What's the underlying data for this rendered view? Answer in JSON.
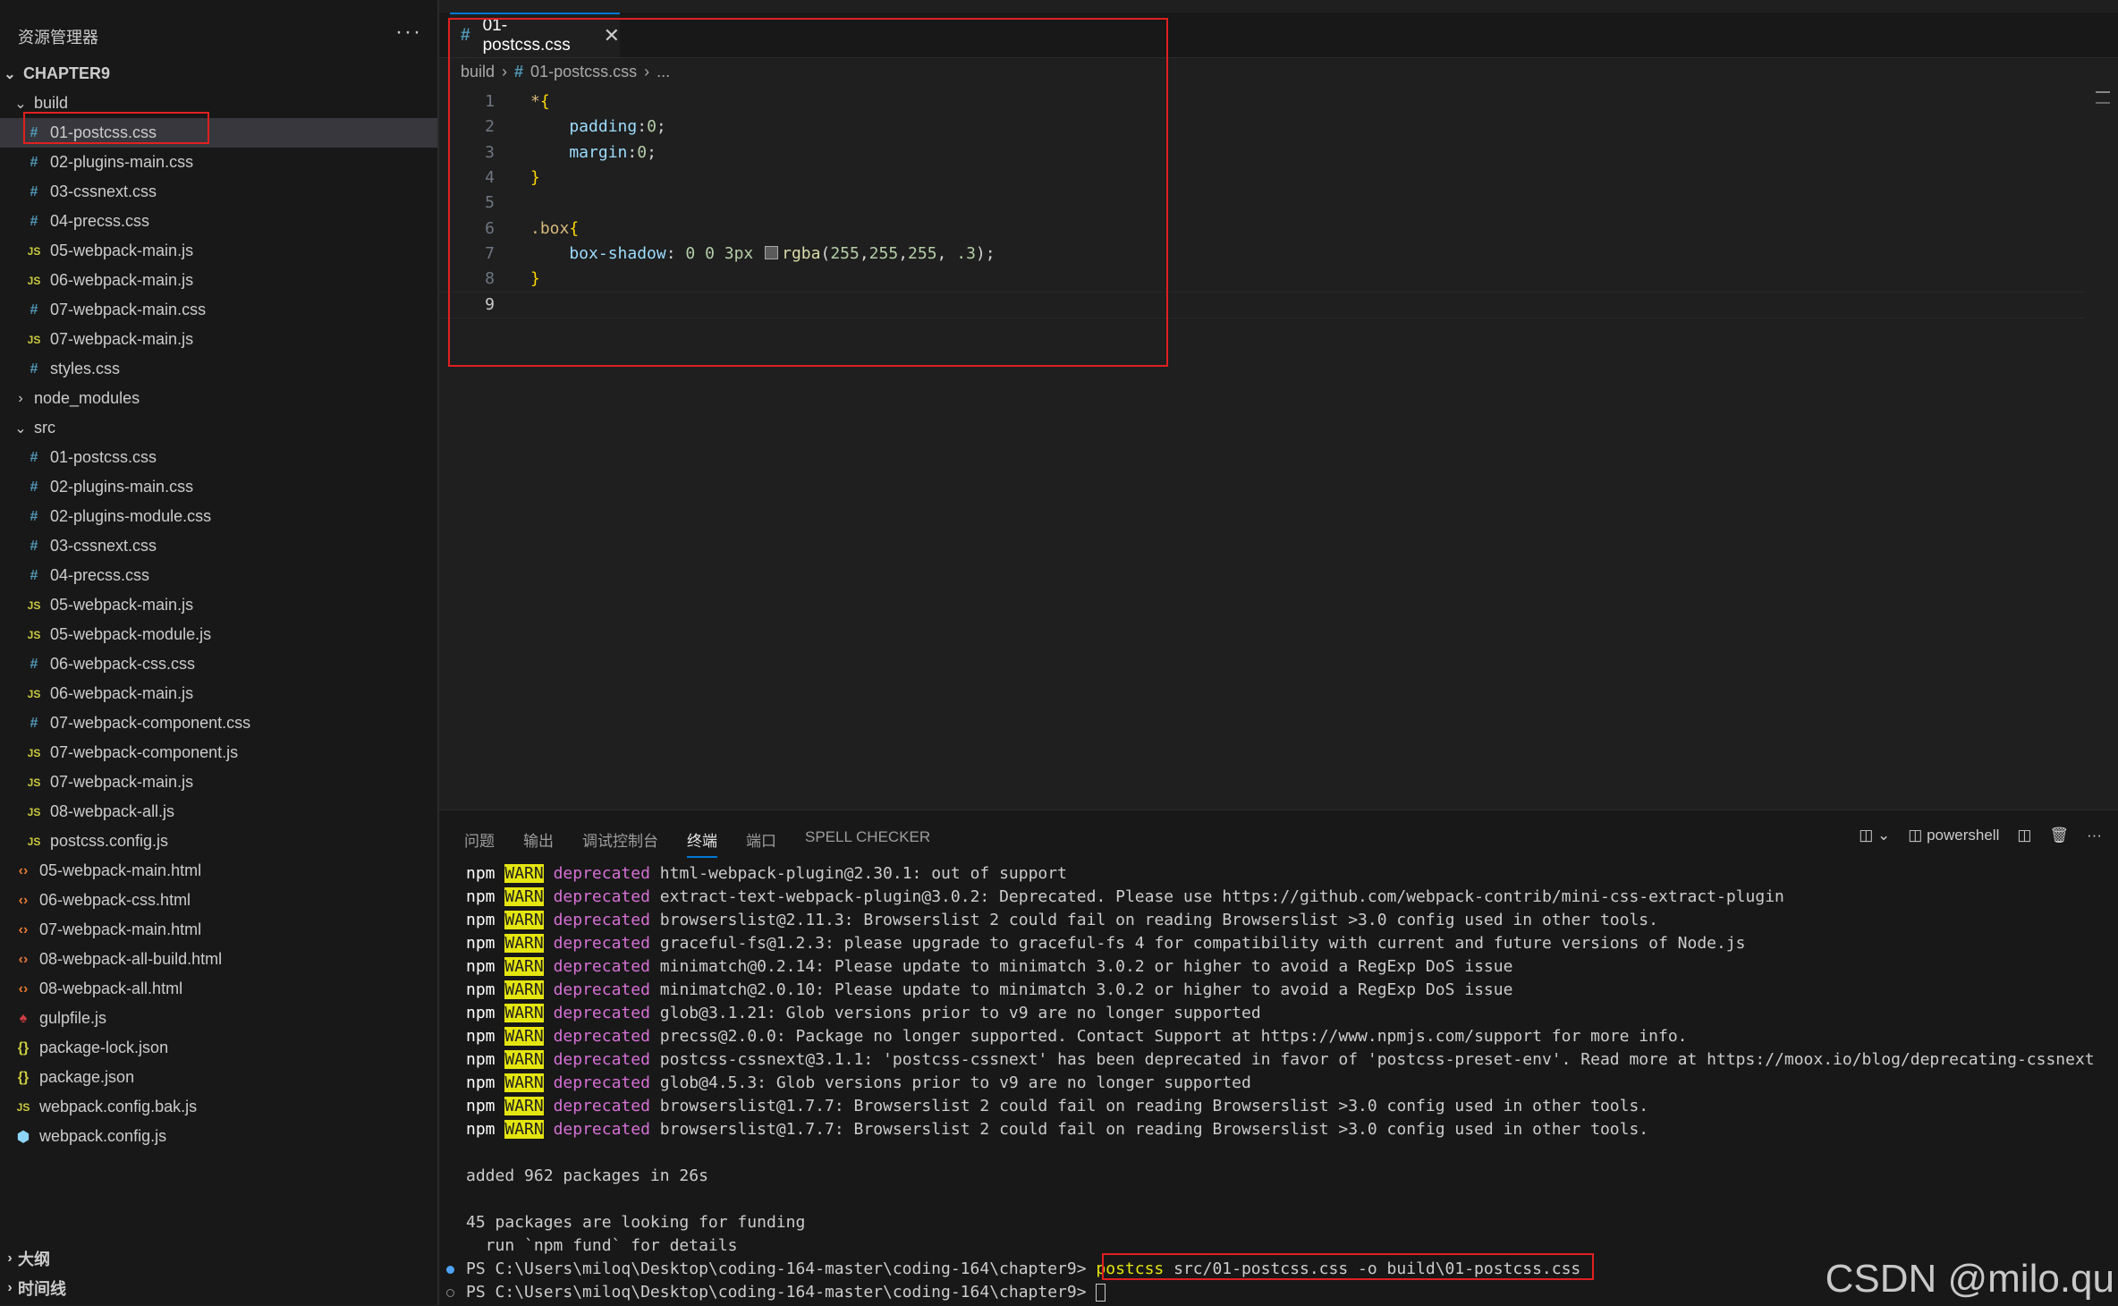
{
  "explorer": {
    "title": "资源管理器",
    "more": "···",
    "project": "CHAPTER9",
    "items": [
      {
        "label": "CHAPTER9",
        "type": "root",
        "depth": 0,
        "expanded": true
      },
      {
        "label": "build",
        "type": "folder",
        "depth": 1,
        "expanded": true
      },
      {
        "label": "01-postcss.css",
        "type": "css",
        "depth": 2,
        "selected": true
      },
      {
        "label": "02-plugins-main.css",
        "type": "css",
        "depth": 2
      },
      {
        "label": "03-cssnext.css",
        "type": "css",
        "depth": 2
      },
      {
        "label": "04-precss.css",
        "type": "css",
        "depth": 2
      },
      {
        "label": "05-webpack-main.js",
        "type": "js",
        "depth": 2
      },
      {
        "label": "06-webpack-main.js",
        "type": "js",
        "depth": 2
      },
      {
        "label": "07-webpack-main.css",
        "type": "css",
        "depth": 2
      },
      {
        "label": "07-webpack-main.js",
        "type": "js",
        "depth": 2
      },
      {
        "label": "styles.css",
        "type": "css",
        "depth": 2
      },
      {
        "label": "node_modules",
        "type": "folder",
        "depth": 1,
        "expanded": false
      },
      {
        "label": "src",
        "type": "folder",
        "depth": 1,
        "expanded": true
      },
      {
        "label": "01-postcss.css",
        "type": "css",
        "depth": 2
      },
      {
        "label": "02-plugins-main.css",
        "type": "css",
        "depth": 2
      },
      {
        "label": "02-plugins-module.css",
        "type": "css",
        "depth": 2
      },
      {
        "label": "03-cssnext.css",
        "type": "css",
        "depth": 2
      },
      {
        "label": "04-precss.css",
        "type": "css",
        "depth": 2
      },
      {
        "label": "05-webpack-main.js",
        "type": "js",
        "depth": 2
      },
      {
        "label": "05-webpack-module.js",
        "type": "js",
        "depth": 2
      },
      {
        "label": "06-webpack-css.css",
        "type": "css",
        "depth": 2
      },
      {
        "label": "06-webpack-main.js",
        "type": "js",
        "depth": 2
      },
      {
        "label": "07-webpack-component.css",
        "type": "css",
        "depth": 2
      },
      {
        "label": "07-webpack-component.js",
        "type": "js",
        "depth": 2
      },
      {
        "label": "07-webpack-main.js",
        "type": "js",
        "depth": 2
      },
      {
        "label": "08-webpack-all.js",
        "type": "js",
        "depth": 2
      },
      {
        "label": "postcss.config.js",
        "type": "js",
        "depth": 2
      },
      {
        "label": "05-webpack-main.html",
        "type": "html",
        "depth": 1
      },
      {
        "label": "06-webpack-css.html",
        "type": "html",
        "depth": 1
      },
      {
        "label": "07-webpack-main.html",
        "type": "html",
        "depth": 1
      },
      {
        "label": "08-webpack-all-build.html",
        "type": "html",
        "depth": 1
      },
      {
        "label": "08-webpack-all.html",
        "type": "html",
        "depth": 1
      },
      {
        "label": "gulpfile.js",
        "type": "gulp",
        "depth": 1
      },
      {
        "label": "package-lock.json",
        "type": "json",
        "depth": 1
      },
      {
        "label": "package.json",
        "type": "json",
        "depth": 1
      },
      {
        "label": "webpack.config.bak.js",
        "type": "js",
        "depth": 1
      },
      {
        "label": "webpack.config.js",
        "type": "webpack",
        "depth": 1
      }
    ],
    "outline": "大纲",
    "timeline": "时间线"
  },
  "editor": {
    "tab_label": "01-postcss.css",
    "tab_close": "✕",
    "breadcrumb": [
      "build",
      "01-postcss.css",
      "..."
    ],
    "active_line": 9,
    "lines": [
      {
        "n": "1",
        "tokens": [
          {
            "t": "*",
            "c": "t-sel"
          },
          {
            "t": "{",
            "c": "t-br"
          }
        ]
      },
      {
        "n": "2",
        "tokens": [
          {
            "t": "    padding",
            "c": "t-prop"
          },
          {
            "t": ":",
            "c": "t-punc"
          },
          {
            "t": "0",
            "c": "t-num"
          },
          {
            "t": ";",
            "c": "t-punc"
          }
        ]
      },
      {
        "n": "3",
        "tokens": [
          {
            "t": "    margin",
            "c": "t-prop"
          },
          {
            "t": ":",
            "c": "t-punc"
          },
          {
            "t": "0",
            "c": "t-num"
          },
          {
            "t": ";",
            "c": "t-punc"
          }
        ]
      },
      {
        "n": "4",
        "tokens": [
          {
            "t": "}",
            "c": "t-br"
          }
        ]
      },
      {
        "n": "5",
        "tokens": []
      },
      {
        "n": "6",
        "tokens": [
          {
            "t": ".box",
            "c": "t-sel"
          },
          {
            "t": "{",
            "c": "t-br"
          }
        ]
      },
      {
        "n": "7",
        "tokens": [
          {
            "t": "    box-shadow",
            "c": "t-prop"
          },
          {
            "t": ": ",
            "c": "t-punc"
          },
          {
            "t": "0 0 3px ",
            "c": "t-num"
          },
          {
            "swatch": true
          },
          {
            "t": "rgba",
            "c": "t-fn"
          },
          {
            "t": "(",
            "c": "t-punc"
          },
          {
            "t": "255",
            "c": "t-num"
          },
          {
            "t": ",",
            "c": "t-punc"
          },
          {
            "t": "255",
            "c": "t-num"
          },
          {
            "t": ",",
            "c": "t-punc"
          },
          {
            "t": "255",
            "c": "t-num"
          },
          {
            "t": ", ",
            "c": "t-punc"
          },
          {
            "t": ".3",
            "c": "t-num"
          },
          {
            "t": ");",
            "c": "t-punc"
          }
        ]
      },
      {
        "n": "8",
        "tokens": [
          {
            "t": "}",
            "c": "t-br"
          }
        ]
      },
      {
        "n": "9",
        "tokens": []
      }
    ]
  },
  "panel": {
    "tabs": [
      "问题",
      "输出",
      "调试控制台",
      "终端",
      "端口",
      "SPELL CHECKER"
    ],
    "active_tab": "终端",
    "shell": "powershell",
    "terminal": {
      "warnings": [
        {
          "pkg": "html-webpack-plugin@2.30.1: out of support"
        },
        {
          "pkg": "extract-text-webpack-plugin@3.0.2: Deprecated. Please use https://github.com/webpack-contrib/mini-css-extract-plugin"
        },
        {
          "pkg": "browserslist@2.11.3: Browserslist 2 could fail on reading Browserslist >3.0 config used in other tools."
        },
        {
          "pkg": "graceful-fs@1.2.3: please upgrade to graceful-fs 4 for compatibility with current and future versions of Node.js"
        },
        {
          "pkg": "minimatch@0.2.14: Please update to minimatch 3.0.2 or higher to avoid a RegExp DoS issue"
        },
        {
          "pkg": "minimatch@2.0.10: Please update to minimatch 3.0.2 or higher to avoid a RegExp DoS issue"
        },
        {
          "pkg": "glob@3.1.21: Glob versions prior to v9 are no longer supported"
        },
        {
          "pkg": "precss@2.0.0: Package no longer supported. Contact Support at https://www.npmjs.com/support for more info."
        },
        {
          "pkg": "postcss-cssnext@3.1.1: 'postcss-cssnext' has been deprecated in favor of 'postcss-preset-env'. Read more at https://moox.io/blog/deprecating-cssnext"
        },
        {
          "pkg": "glob@4.5.3: Glob versions prior to v9 are no longer supported"
        },
        {
          "pkg": "browserslist@1.7.7: Browserslist 2 could fail on reading Browserslist >3.0 config used in other tools."
        },
        {
          "pkg": "browserslist@1.7.7: Browserslist 2 could fail on reading Browserslist >3.0 config used in other tools."
        }
      ],
      "npm": "npm",
      "warn": "WARN",
      "deprecated": "deprecated",
      "added": "added 962 packages in 26s",
      "funding1": "45 packages are looking for funding",
      "funding2": "  run `npm fund` for details",
      "prompt": "PS C:\\Users\\miloq\\Desktop\\coding-164-master\\coding-164\\chapter9> ",
      "cmd_name": "postcss",
      "cmd_args": " src/01-postcss.css -o build\\01-postcss.css"
    }
  },
  "watermark": "CSDN @milo.qu"
}
